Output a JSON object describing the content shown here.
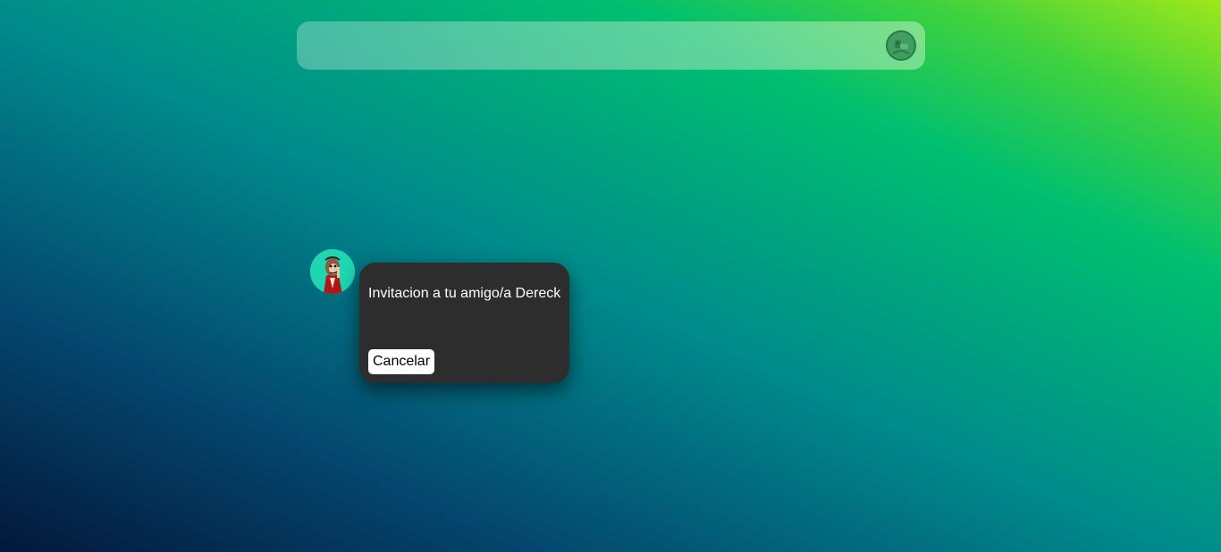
{
  "header": {
    "profile_icon": "user-avatar-icon"
  },
  "invitation": {
    "sender_avatar_icon": "monkey-avatar-icon",
    "message": "Invitacion a tu amigo/a Dereck",
    "cancel_label": "Cancelar"
  },
  "colors": {
    "card_background": "#2d2d2d",
    "avatar_background": "#1fd6b0",
    "button_background": "#ffffff"
  }
}
